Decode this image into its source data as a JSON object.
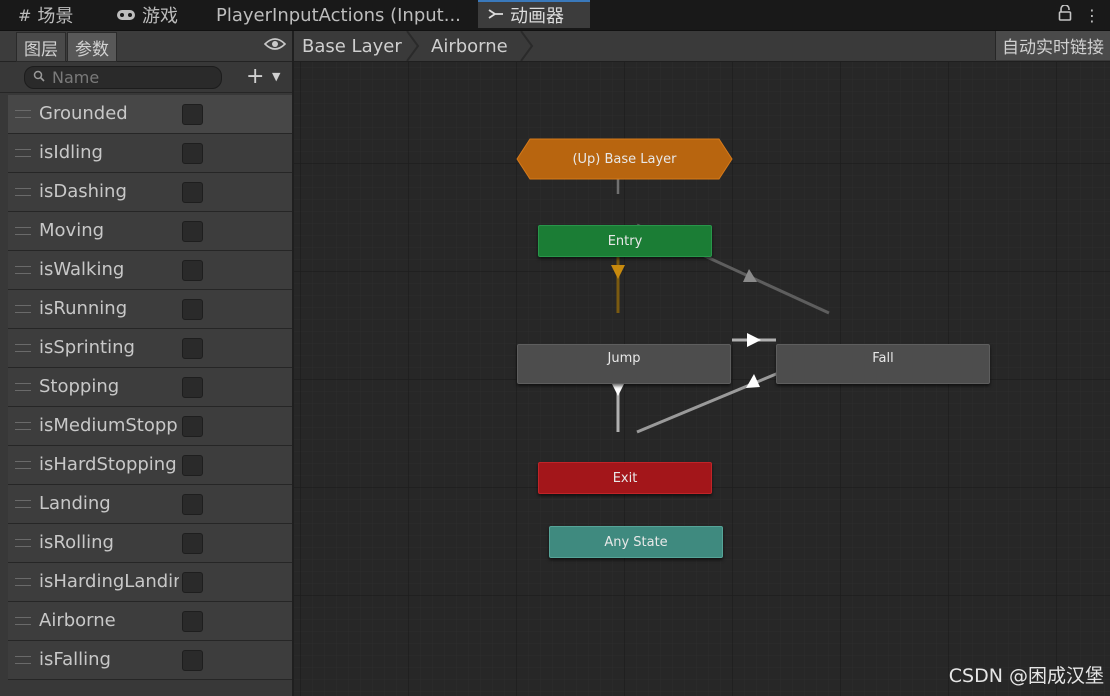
{
  "tabs": [
    {
      "label": "场景",
      "icon": "grid-icon"
    },
    {
      "label": "游戏",
      "icon": "gamepad-icon"
    },
    {
      "label": "PlayerInputActions (Input...",
      "icon": ""
    },
    {
      "label": "动画器",
      "icon": "animator-icon"
    }
  ],
  "left_panel": {
    "tabs": [
      "图层",
      "参数"
    ],
    "search_placeholder": "Name",
    "add_label": "+",
    "parameters": [
      {
        "name": "Grounded",
        "checked": false
      },
      {
        "name": "isIdling",
        "checked": false
      },
      {
        "name": "isDashing",
        "checked": false
      },
      {
        "name": "Moving",
        "checked": false
      },
      {
        "name": "isWalking",
        "checked": false
      },
      {
        "name": "isRunning",
        "checked": false
      },
      {
        "name": "isSprinting",
        "checked": false
      },
      {
        "name": "Stopping",
        "checked": false
      },
      {
        "name": "isMediumStopping",
        "checked": false
      },
      {
        "name": "isHardStopping",
        "checked": false
      },
      {
        "name": "Landing",
        "checked": false
      },
      {
        "name": "isRolling",
        "checked": false
      },
      {
        "name": "isHardingLanding",
        "checked": false
      },
      {
        "name": "Airborne",
        "checked": false
      },
      {
        "name": "isFalling",
        "checked": false
      }
    ]
  },
  "graph": {
    "breadcrumbs": [
      "Base Layer",
      "Airborne"
    ],
    "auto_live_link": "自动实时链接",
    "states": {
      "up": "(Up) Base Layer",
      "entry": "Entry",
      "jump": "Jump",
      "fall": "Fall",
      "exit": "Exit",
      "any": "Any State"
    },
    "colors": {
      "up": "#b8650f",
      "entry": "#1b7d35",
      "jump": "#4d4d4d",
      "fall": "#4d4d4d",
      "exit": "#a3161a",
      "any": "#3f8a7f"
    }
  },
  "watermark": "CSDN @困成汉堡"
}
